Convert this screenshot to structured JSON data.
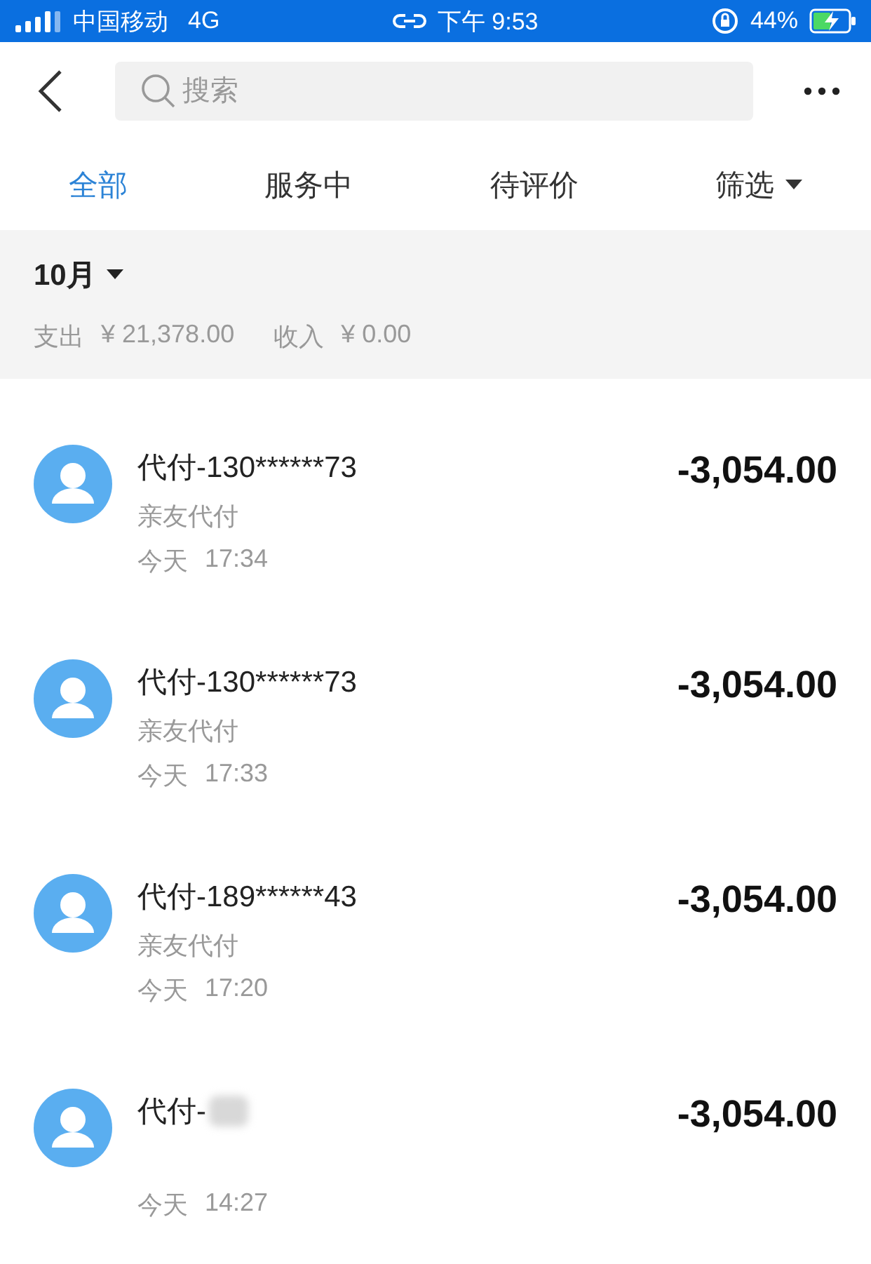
{
  "status_bar": {
    "carrier": "中国移动",
    "network": "4G",
    "time": "下午 9:53",
    "battery": "44%"
  },
  "search": {
    "placeholder": "搜索"
  },
  "tabs": [
    {
      "label": "全部",
      "selected": true,
      "kind": "tab"
    },
    {
      "label": "服务中",
      "selected": false,
      "kind": "tab"
    },
    {
      "label": "待评价",
      "selected": false,
      "kind": "tab"
    },
    {
      "label": "筛选",
      "selected": false,
      "kind": "dropdown"
    }
  ],
  "month": {
    "label": "10月"
  },
  "summary": {
    "expense_label": "支出",
    "expense": "¥ 21,378.00",
    "income_label": "收入",
    "income": "¥ 0.00"
  },
  "transactions": [
    {
      "title": "代付-130******73",
      "subtitle": "亲友代付",
      "day": "今天",
      "time": "17:34",
      "amount": "-3,054.00",
      "redacted": false
    },
    {
      "title": "代付-130******73",
      "subtitle": "亲友代付",
      "day": "今天",
      "time": "17:33",
      "amount": "-3,054.00",
      "redacted": false
    },
    {
      "title": "代付-189******43",
      "subtitle": "亲友代付",
      "day": "今天",
      "time": "17:20",
      "amount": "-3,054.00",
      "redacted": false
    },
    {
      "title": "代付-",
      "day": "今天",
      "time": "14:27",
      "amount": "-3,054.00",
      "redacted": true
    }
  ]
}
